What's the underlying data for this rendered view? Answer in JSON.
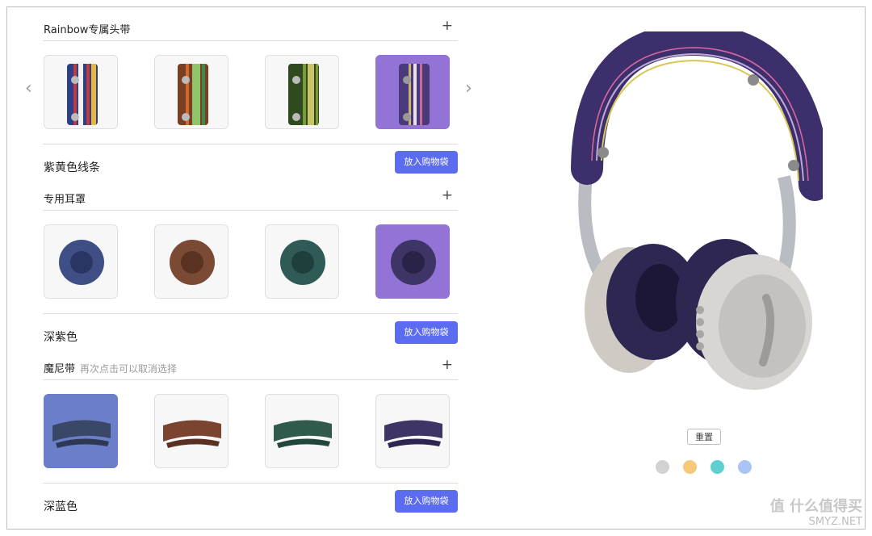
{
  "sections": [
    {
      "title": "Rainbow专属头带",
      "hint": "",
      "plus": "+",
      "selected_label": "紫黄色线条",
      "cart_label": "放入购物袋",
      "options": [
        {
          "name": "rainbow-navy",
          "colors": [
            "#2b3f8a",
            "#c43a3a",
            "#f2f2f2",
            "#e6b83a"
          ]
        },
        {
          "name": "rainbow-brown",
          "colors": [
            "#7a3e22",
            "#d16a2e",
            "#8fc46a",
            "#3e8a4a"
          ]
        },
        {
          "name": "rainbow-green",
          "colors": [
            "#2f4a1e",
            "#7a9a3a",
            "#c9c36a",
            "#4a6a2a"
          ]
        },
        {
          "name": "rainbow-purple",
          "colors": [
            "#4a3a7a",
            "#e8e0f0",
            "#c7b46a",
            "#7a5aa8"
          ]
        }
      ],
      "selected_index": 3
    },
    {
      "title": "专用耳罩",
      "hint": "",
      "plus": "+",
      "selected_label": "深紫色",
      "cart_label": "放入购物袋",
      "options": [
        {
          "name": "earpad-blue",
          "color": "#3f4f86",
          "inner": "#2b3564"
        },
        {
          "name": "earpad-brown",
          "color": "#7b4a35",
          "inner": "#5a3222"
        },
        {
          "name": "earpad-teal",
          "color": "#2f5a55",
          "inner": "#1f3f3c"
        },
        {
          "name": "earpad-purple",
          "color": "#3e3466",
          "inner": "#2a2348"
        }
      ],
      "selected_index": 3
    },
    {
      "title": "魔尼带",
      "hint": "再次点击可以取消选择",
      "plus": "+",
      "selected_label": "深蓝色",
      "cart_label": "放入购物袋",
      "options": [
        {
          "name": "strap-blue",
          "color": "#3b4766"
        },
        {
          "name": "strap-brown",
          "color": "#7a4430"
        },
        {
          "name": "strap-green",
          "color": "#2f5a4c"
        },
        {
          "name": "strap-purple",
          "color": "#3f3466"
        }
      ],
      "selected_index": 0
    }
  ],
  "nav": {
    "prev": "‹",
    "next": "›"
  },
  "preview": {
    "reset_label": "重置",
    "swatches": [
      "#d2d2d2",
      "#f6c87a",
      "#5fcfcf",
      "#a9c4f5"
    ]
  },
  "watermark": {
    "main": "值 什么值得买",
    "sub": "SMYZ.NET"
  },
  "colors": {
    "accent": "#5c6cf0",
    "selected_purple": "#9473d6",
    "selected_blue": "#6b7ec9",
    "headband": "#3d2f6b"
  }
}
